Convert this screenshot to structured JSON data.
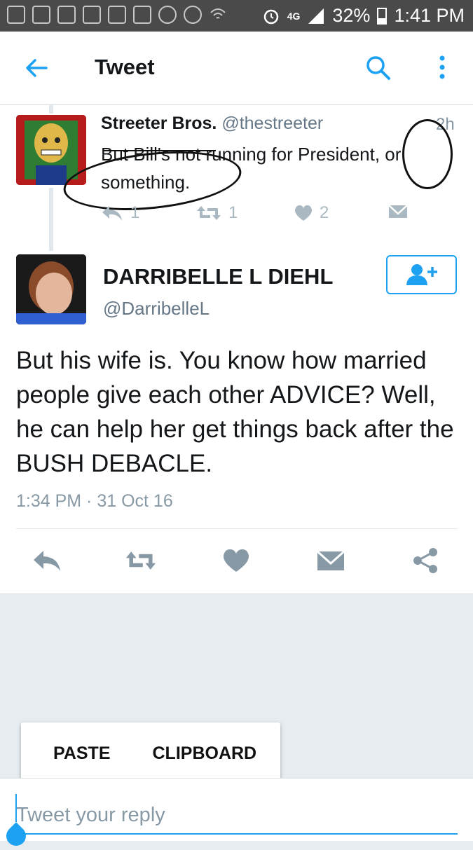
{
  "status_bar": {
    "network": "4G",
    "battery": "32%",
    "time": "1:41 PM"
  },
  "header": {
    "title": "Tweet"
  },
  "parent_tweet": {
    "name": "Streeter Bros.",
    "handle": "@thestreeter",
    "time": "2h",
    "text": "But Bill's not running for President, or something.",
    "reply_count": "1",
    "retweet_count": "1",
    "like_count": "2"
  },
  "main_tweet": {
    "name": "DARRIBELLE L DIEHL",
    "handle": "@DarribelleL",
    "text": "But his wife is.  You know how married people give each other ADVICE?  Well, he can help her get things back after the BUSH DEBACLE.",
    "timestamp": "1:34 PM · 31 Oct 16"
  },
  "popup": {
    "paste": "PASTE",
    "clipboard": "CLIPBOARD"
  },
  "reply": {
    "placeholder": "Tweet your reply"
  },
  "colors": {
    "accent": "#1da1f2",
    "icon_gray": "#8899a6",
    "background": "#e6ecf0"
  }
}
